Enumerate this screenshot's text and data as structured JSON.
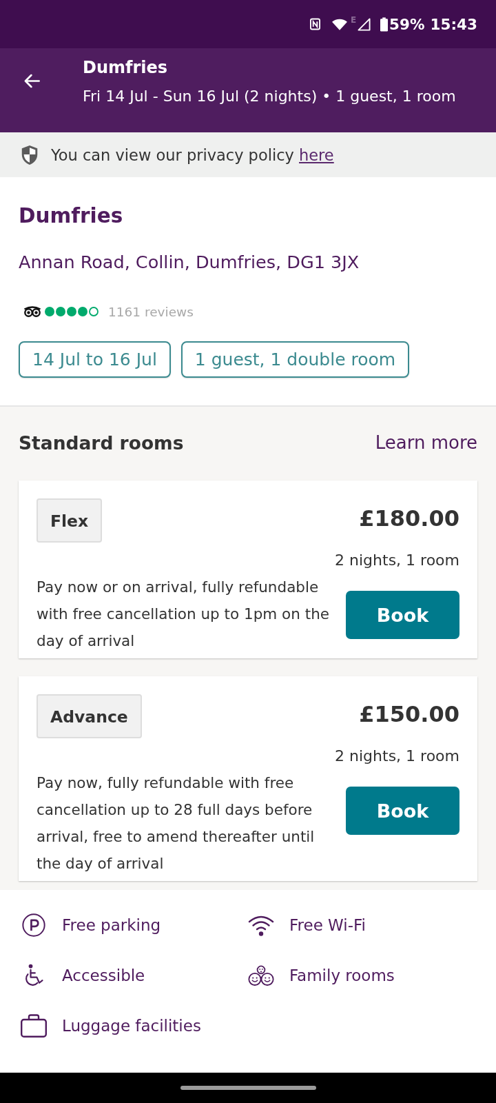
{
  "status_bar": {
    "network": "E",
    "battery": "59%",
    "time": "15:43"
  },
  "header": {
    "title": "Dumfries",
    "subtitle": "Fri 14 Jul - Sun 16 Jul (2 nights) • 1 guest, 1 room"
  },
  "privacy_notice": {
    "text": "You can view our privacy policy",
    "link": "here"
  },
  "hotel": {
    "name": "Dumfries",
    "address": "Annan Road, Collin, Dumfries, DG1 3JX",
    "rating": {
      "stars": 4,
      "reviews": "1161 reviews"
    },
    "chips": [
      "14 Jul to 16 Jul",
      "1 guest, 1 double room"
    ]
  },
  "rooms": {
    "title": "Standard rooms",
    "link": "Learn more",
    "rates": [
      {
        "name": "Flex",
        "price": "£180.00",
        "duration": "2 nights, 1 room",
        "description": "Pay now or on arrival, fully refundable with free cancellation up to 1pm on the day of arrival",
        "button": "Book"
      },
      {
        "name": "Advance",
        "price": "£150.00",
        "duration": "2 nights, 1 room",
        "description": "Pay now, fully refundable with free cancellation up to 28 full days before arrival, free to amend thereafter until the day of arrival",
        "button": "Book"
      }
    ]
  },
  "amenities": [
    {
      "kind": "parking",
      "label": "Free parking"
    },
    {
      "kind": "wifi",
      "label": "Free Wi-Fi"
    },
    {
      "kind": "accessible",
      "label": "Accessible"
    },
    {
      "kind": "family",
      "label": "Family rooms"
    },
    {
      "kind": "luggage",
      "label": "Luggage facilities"
    }
  ]
}
